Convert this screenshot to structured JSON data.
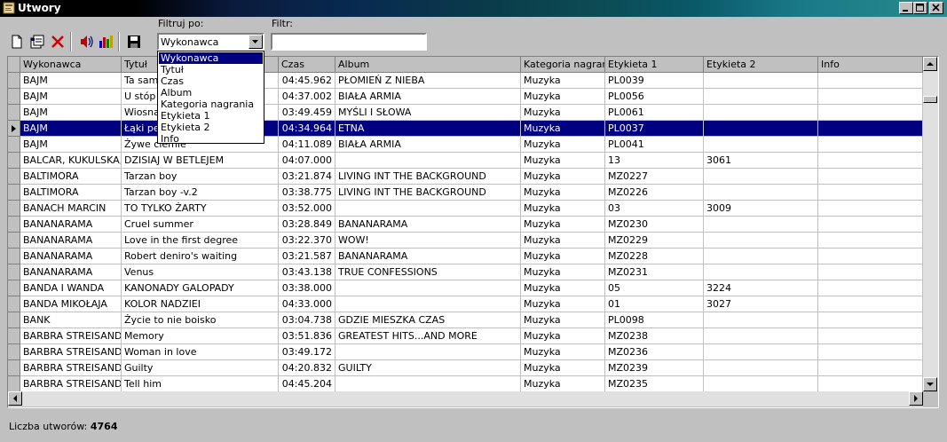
{
  "window": {
    "title": "Utwory",
    "controls": [
      "minimize-icon",
      "maximize-icon",
      "close-icon"
    ]
  },
  "toolbar": {
    "icons": [
      "new-document-icon",
      "properties-icon",
      "delete-icon",
      "sound-icon",
      "chart-icon",
      "save-icon"
    ],
    "filter_by_label": "Filtruj po:",
    "filter_by_value": "Wykonawca",
    "filter_label": "Filtr:",
    "filter_value": ""
  },
  "filter_options": [
    "Wykonawca",
    "Tytuł",
    "Czas",
    "Album",
    "Kategoria nagrania",
    "Etykieta 1",
    "Etykieta 2",
    "Info"
  ],
  "colors": {
    "selection": "#000080",
    "face": "#c0c0c0"
  },
  "table": {
    "columns": [
      "Wykonawca",
      "Tytuł",
      "Czas",
      "Album",
      "Kategoria nagrania",
      "Etykieta 1",
      "Etykieta 2",
      "Info"
    ],
    "selected_row": 3,
    "rows": [
      [
        "BAJM",
        "Ta sama",
        "04:45.962",
        "PŁOMIEŃ Z NIEBA",
        "Muzyka",
        "PL0039",
        "",
        ""
      ],
      [
        "BAJM",
        "U stóp s",
        "04:37.002",
        "BIAŁA ARMIA",
        "Muzyka",
        "PL0056",
        "",
        ""
      ],
      [
        "BAJM",
        "Wiosna",
        "03:49.459",
        "MYŚLI I SŁOWA",
        "Muzyka",
        "PL0061",
        "",
        ""
      ],
      [
        "BAJM",
        "Łąki pe",
        "04:34.964",
        "ETNA",
        "Muzyka",
        "PL0037",
        "",
        ""
      ],
      [
        "BAJM",
        "Żywe ciemie",
        "04:11.089",
        "BIAŁA ARMIA",
        "Muzyka",
        "PL0041",
        "",
        ""
      ],
      [
        "BALCAR, KUKULSKA,",
        "DZISIAJ W BETLEJEM",
        "04:07.000",
        "",
        "Muzyka",
        "13",
        "3061",
        ""
      ],
      [
        "BALTIMORA",
        "Tarzan boy",
        "03:21.874",
        "LIVING INT THE BACKGROUND",
        "Muzyka",
        "MZ0227",
        "",
        ""
      ],
      [
        "BALTIMORA",
        "Tarzan boy -v.2",
        "03:38.775",
        "LIVING INT THE BACKGROUND",
        "Muzyka",
        "MZ0226",
        "",
        ""
      ],
      [
        "BANACH MARCIN",
        "TO TYLKO ŻARTY",
        "03:52.000",
        "",
        "Muzyka",
        "03",
        "3009",
        ""
      ],
      [
        "BANANARAMA",
        "Cruel summer",
        "03:28.849",
        "BANANARAMA",
        "Muzyka",
        "MZ0230",
        "",
        ""
      ],
      [
        "BANANARAMA",
        "Love in the first degree",
        "03:22.370",
        "WOW!",
        "Muzyka",
        "MZ0229",
        "",
        ""
      ],
      [
        "BANANARAMA",
        "Robert deniro's waiting",
        "03:21.587",
        "BANANARAMA",
        "Muzyka",
        "MZ0228",
        "",
        ""
      ],
      [
        "BANANARAMA",
        "Venus",
        "03:43.138",
        "TRUE CONFESSIONS",
        "Muzyka",
        "MZ0231",
        "",
        ""
      ],
      [
        "BANDA I WANDA",
        "KANONADY GALOPADY",
        "03:38.000",
        "",
        "Muzyka",
        "05",
        "3224",
        ""
      ],
      [
        "BANDA MIKOŁAJA",
        "KOLOR NADZIEI",
        "04:33.000",
        "",
        "Muzyka",
        "01",
        "3027",
        ""
      ],
      [
        "BANK",
        "Życie to nie boisko",
        "03:04.738",
        "GDZIE MIESZKA CZAS",
        "Muzyka",
        "PL0098",
        "",
        ""
      ],
      [
        "BARBRA STREISAND",
        "Memory",
        "03:51.836",
        "GREATEST HITS...AND MORE",
        "Muzyka",
        "MZ0238",
        "",
        ""
      ],
      [
        "BARBRA STREISAND",
        "Woman in love",
        "03:49.172",
        "",
        "Muzyka",
        "MZ0236",
        "",
        ""
      ],
      [
        "BARBRA STREISAND",
        "Guilty",
        "04:20.832",
        "GUILTY",
        "Muzyka",
        "MZ0239",
        "",
        ""
      ],
      [
        "BARBRA STREISAND",
        "Tell him",
        "04:45.204",
        "",
        "Muzyka",
        "MZ0235",
        "",
        ""
      ]
    ]
  },
  "status": {
    "label": "Liczba utworów:",
    "count": "4764"
  }
}
